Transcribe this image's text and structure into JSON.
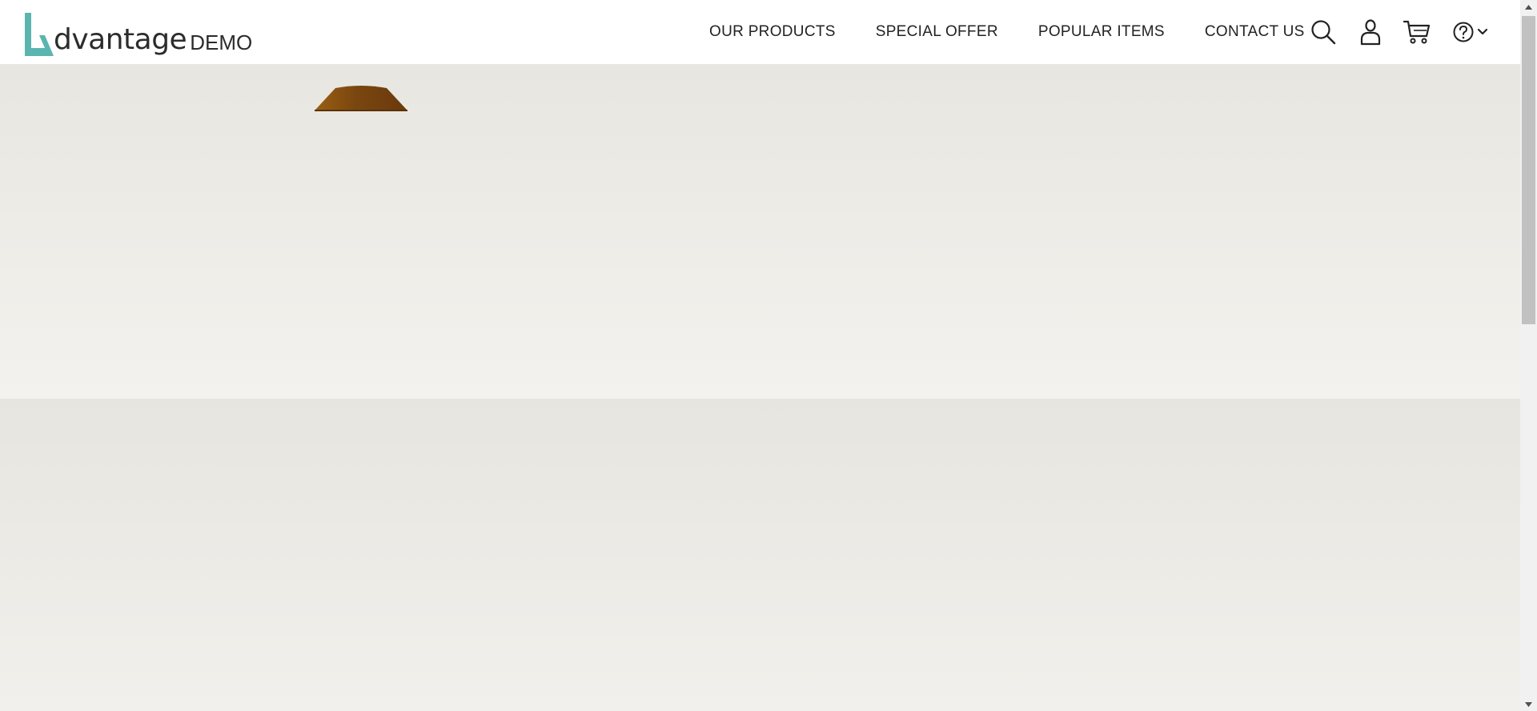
{
  "brand": {
    "name": "dvantage",
    "suffix": "DEMO",
    "accent_color": "#5ab5b0"
  },
  "nav": {
    "items": [
      {
        "label": "OUR PRODUCTS"
      },
      {
        "label": "SPECIAL OFFER"
      },
      {
        "label": "POPULAR ITEMS"
      },
      {
        "label": "CONTACT US"
      }
    ]
  },
  "header_icons": [
    "search-icon",
    "user-icon",
    "cart-icon",
    "help-icon",
    "chevron-down-icon"
  ],
  "hero": {
    "background_top": "#e8e6e0",
    "background_bottom": "#f3f2ee",
    "image": "lamp-shade"
  },
  "scrollbar": {
    "thumb_color": "#c1c1c1"
  }
}
